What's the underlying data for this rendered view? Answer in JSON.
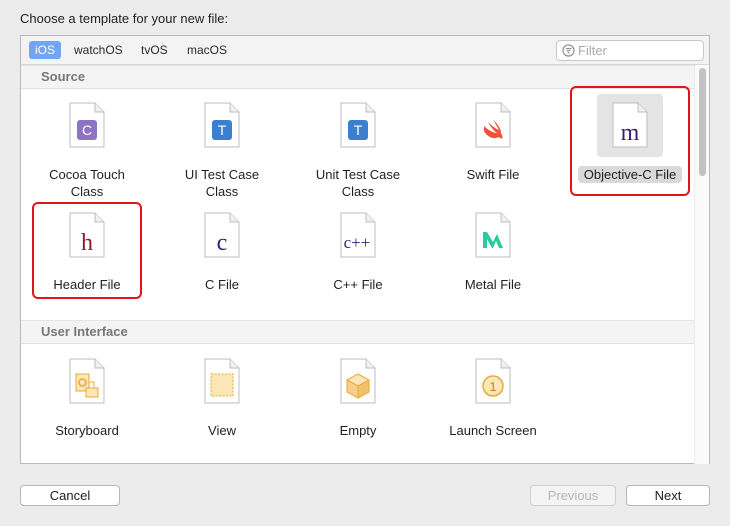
{
  "prompt": "Choose a template for your new file:",
  "platforms": [
    {
      "label": "iOS",
      "active": true
    },
    {
      "label": "watchOS",
      "active": false
    },
    {
      "label": "tvOS",
      "active": false
    },
    {
      "label": "macOS",
      "active": false
    }
  ],
  "filter": {
    "placeholder": "Filter",
    "value": ""
  },
  "sections": {
    "source": {
      "title": "Source",
      "items": [
        {
          "label": "Cocoa Touch Class",
          "icon": "cocoa-touch-class-icon",
          "glyph": "C"
        },
        {
          "label": "UI Test Case Class",
          "icon": "ui-test-case-icon",
          "glyph": "T"
        },
        {
          "label": "Unit Test Case Class",
          "icon": "unit-test-case-icon",
          "glyph": "T"
        },
        {
          "label": "Swift File",
          "icon": "swift-icon",
          "glyph": ""
        },
        {
          "label": "Objective-C File",
          "icon": "objective-c-icon",
          "glyph": "m"
        },
        {
          "label": "Header File",
          "icon": "header-file-icon",
          "glyph": "h"
        },
        {
          "label": "C File",
          "icon": "c-file-icon",
          "glyph": "c"
        },
        {
          "label": "C++ File",
          "icon": "cpp-file-icon",
          "glyph": "c++"
        },
        {
          "label": "Metal File",
          "icon": "metal-icon",
          "glyph": ""
        }
      ]
    },
    "user_interface": {
      "title": "User Interface",
      "items": [
        {
          "label": "Storyboard",
          "icon": "storyboard-icon"
        },
        {
          "label": "View",
          "icon": "view-icon"
        },
        {
          "label": "Empty",
          "icon": "empty-interface-icon"
        },
        {
          "label": "Launch Screen",
          "icon": "launch-screen-icon",
          "glyph": "1"
        }
      ]
    }
  },
  "buttons": {
    "cancel": "Cancel",
    "previous": "Previous",
    "next": "Next"
  },
  "colors": {
    "accent": "#71a5f3",
    "highlight": "#e2141b",
    "objc": "#3b1f6e",
    "header": "#8b1d2c",
    "test": "#3a7fd0",
    "swift": "#f05138",
    "metal": "#2bc9a0",
    "storyboard": "#e8a93a"
  }
}
